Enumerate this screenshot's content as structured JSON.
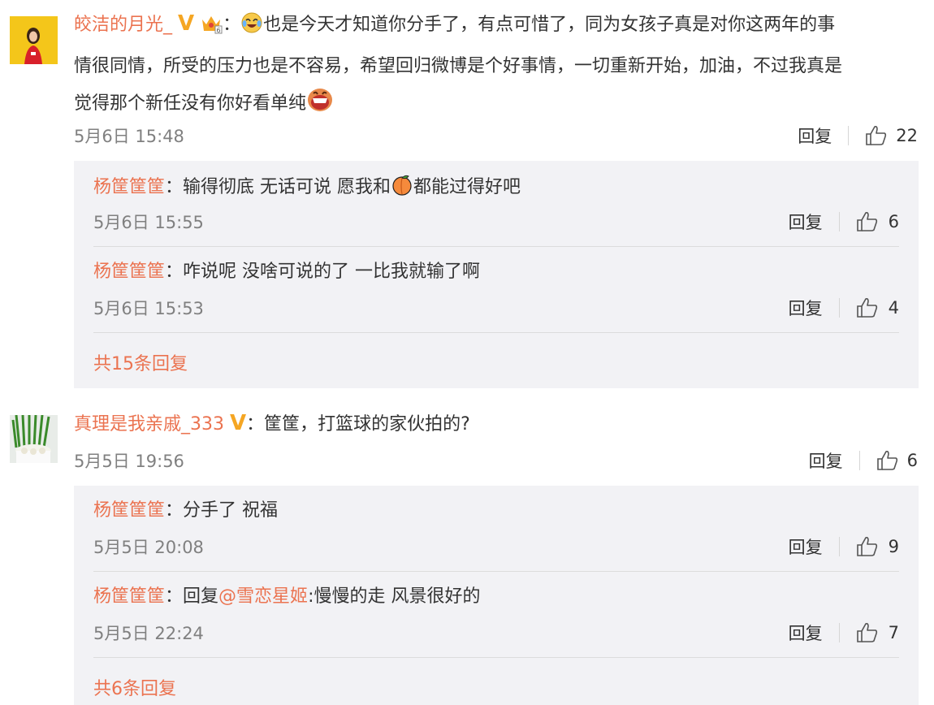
{
  "comments": [
    {
      "user": "皎洁的月光_",
      "text_line1": "也是今天才知道你分手了，有点可惜了，同为女孩子真是对你这两年的事",
      "text_line2": "情很同情，所受的压力也是不容易，希望回归微博是个好事情，一切重新开始，加油，不过我真是",
      "text_line3": "觉得那个新任没有你好看单纯",
      "time": "5月6日 15:48",
      "reply_label": "回复",
      "likes": "22",
      "replies": [
        {
          "user": "杨筐筐筐",
          "text_a": "输得彻底  无话可说  愿我和",
          "text_b": "都能过得好吧",
          "time": "5月6日 15:55",
          "reply_label": "回复",
          "likes": "6"
        },
        {
          "user": "杨筐筐筐",
          "text": "咋说呢 没啥可说的了  一比我就输了啊",
          "time": "5月6日 15:53",
          "reply_label": "回复",
          "likes": "4"
        }
      ],
      "more": "共15条回复"
    },
    {
      "user": "真理是我亲戚_333",
      "text": "筐筐，打篮球的家伙拍的?",
      "time": "5月5日 19:56",
      "reply_label": "回复",
      "likes": "6",
      "replies": [
        {
          "user": "杨筐筐筐",
          "text": "分手了 祝福",
          "time": "5月5日 20:08",
          "reply_label": "回复",
          "likes": "9"
        },
        {
          "user": "杨筐筐筐",
          "reply_prefix": "回复",
          "mention": "@雪恋星姬",
          "text": ":慢慢的走  风景很好的",
          "time": "5月5日 22:24",
          "reply_label": "回复",
          "likes": "7"
        }
      ],
      "more": "共6条回复"
    }
  ],
  "colors": {
    "username": "#eb7350",
    "meta": "#808080",
    "reply_bg": "#f2f2f5"
  },
  "icons": {
    "like": "thumbs-up-icon",
    "verified": "verified-v-icon",
    "crown": "vip-crown-icon"
  }
}
